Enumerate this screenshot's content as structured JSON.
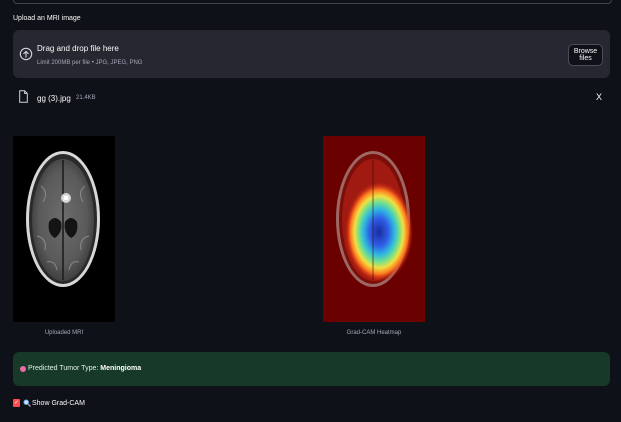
{
  "uploader": {
    "label": "Upload an MRI image",
    "dropzone_title": "Drag and drop file here",
    "dropzone_hint": "Limit 200MB per file • JPG, JPEG, PNG",
    "browse_label": "Browse files"
  },
  "file": {
    "name": "gg (3).jpg",
    "size": "21.4KB",
    "close_label": "X"
  },
  "images": {
    "original_caption": "Uploaded MRI",
    "heatmap_caption": "Grad-CAM Heatmap"
  },
  "result": {
    "prefix": "Predicted Tumor Type:",
    "value": "Meningioma"
  },
  "checkbox": {
    "label": "Show Grad-CAM",
    "checked": true
  },
  "colors": {
    "background": "#0e1117",
    "dropzone": "#262730",
    "success_bg": "#173928",
    "checkbox_accent": "#ff4b4b"
  },
  "icons": [
    "upload-cloud-icon",
    "file-icon",
    "close-icon",
    "pink-circle-icon",
    "magnifier-icon",
    "checkmark-icon"
  ]
}
